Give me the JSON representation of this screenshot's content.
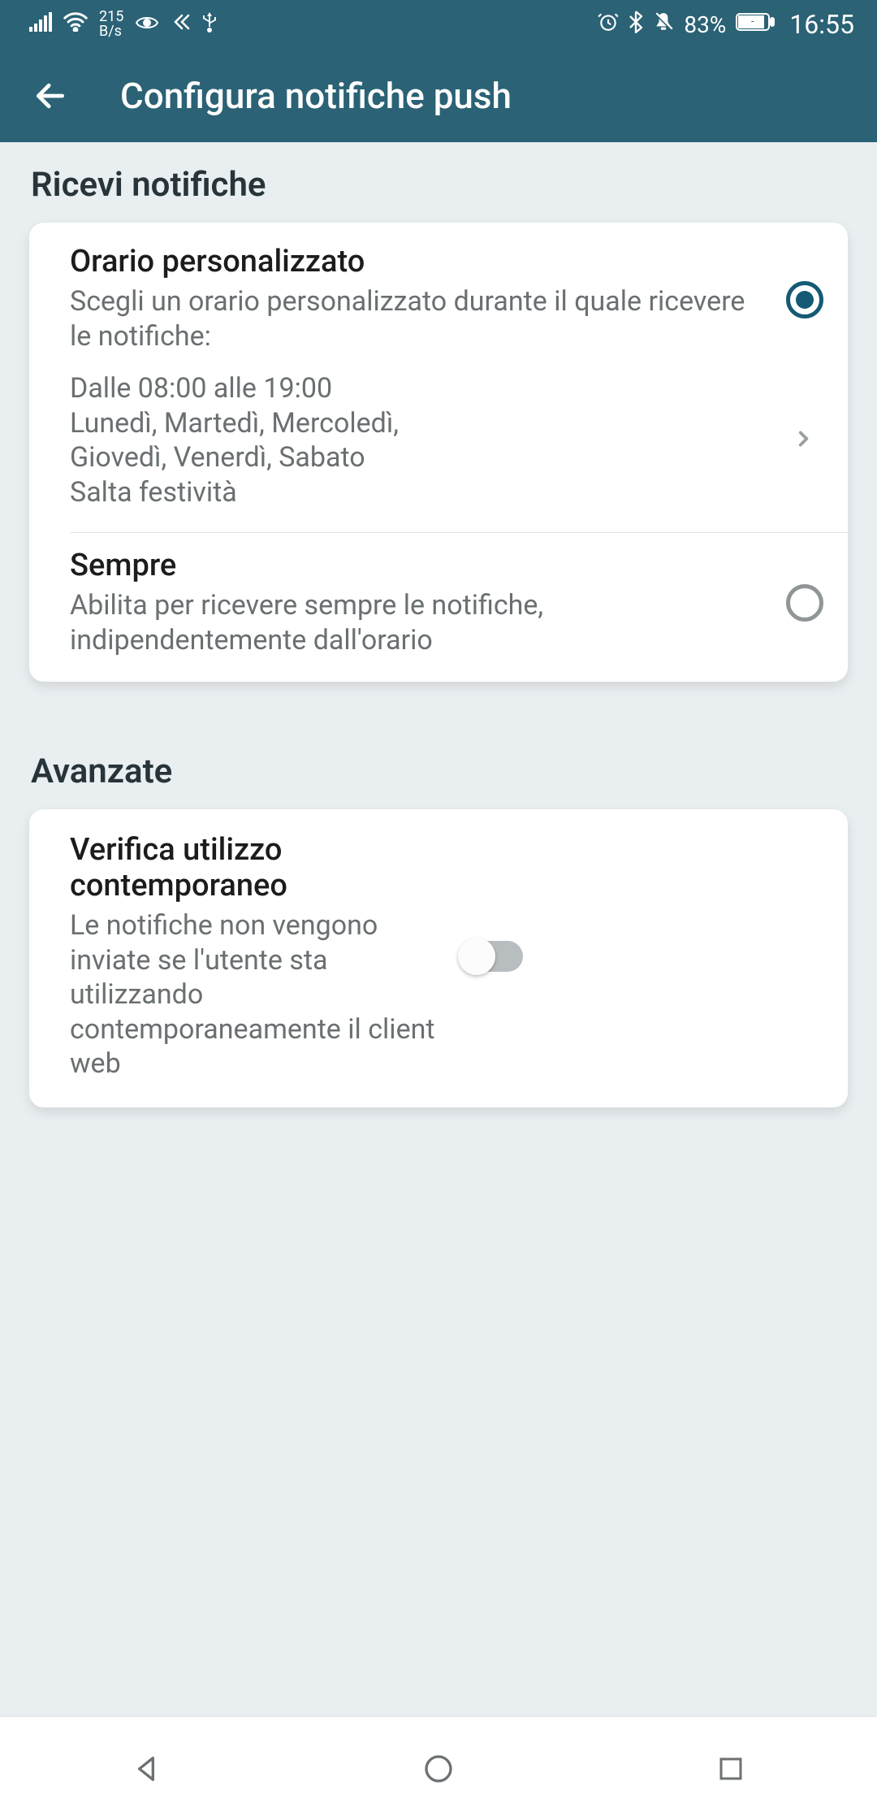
{
  "status": {
    "net_rate": "215",
    "net_unit": "B/s",
    "battery": "83%",
    "time": "16:55"
  },
  "header": {
    "title": "Configura notifiche push"
  },
  "section1": {
    "title": "Ricevi notifiche"
  },
  "opt_custom": {
    "title": "Orario personalizzato",
    "desc": "Scegli un orario personalizzato durante il quale ricevere le notifiche:",
    "schedule_line1": "Dalle 08:00 alle 19:00",
    "schedule_line2": "Lunedì, Martedì, Mercoledì, Giovedì, Venerdì, Sabato",
    "schedule_line3": "Salta festività"
  },
  "opt_always": {
    "title": "Sempre",
    "desc": "Abilita per ricevere sempre le notifiche, indipendentemente dall'orario"
  },
  "section2": {
    "title": "Avanzate"
  },
  "concurrent": {
    "title": "Verifica utilizzo contemporaneo",
    "desc": "Le notifiche non vengono inviate se l'utente sta utilizzando contemporaneamente il client web"
  }
}
